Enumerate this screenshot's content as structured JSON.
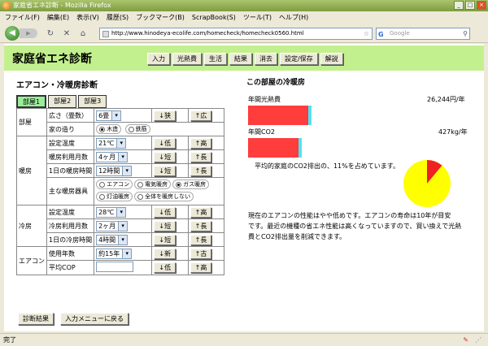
{
  "window": {
    "title": "家庭省エネ診断 - Mozilla Firefox",
    "buttons": [
      "_",
      "□",
      "×"
    ]
  },
  "menu": [
    "ファイル(F)",
    "編集(E)",
    "表示(V)",
    "履歴(S)",
    "ブックマーク(B)",
    "ScrapBook(S)",
    "ツール(T)",
    "ヘルプ(H)"
  ],
  "nav": {
    "url": "http://www.hinodeya-ecolife.com/homecheck/homecheck0560.html",
    "search_placeholder": "Google"
  },
  "header": {
    "title": "家庭省エネ診断",
    "buttons": [
      "入力",
      "光熱費",
      "生活",
      "結果",
      "消去",
      "設定/保存",
      "解説"
    ]
  },
  "form": {
    "title": "エアコン・冷暖房診断",
    "tabs": [
      "部屋1",
      "部屋2",
      "部屋3"
    ],
    "groups": {
      "room": "部屋",
      "heating": "暖房",
      "cooling": "冷房",
      "aircon": "エアコン"
    },
    "rows": {
      "size": {
        "label": "広さ（畳数）",
        "value": "6畳",
        "btn1": "↓狭",
        "btn2": "↑広"
      },
      "structure": {
        "label": "家の造り",
        "opt1": "木造",
        "opt2": "鉄筋"
      },
      "heat_temp": {
        "label": "設定温度",
        "value": "21℃",
        "btn1": "↓低",
        "btn2": "↑高"
      },
      "heat_months": {
        "label": "暖房利用月数",
        "value": "4ヶ月",
        "btn1": "↓短",
        "btn2": "↑長"
      },
      "heat_hours": {
        "label": "1日の暖房時間",
        "value": "12時間",
        "btn1": "↓短",
        "btn2": "↑長"
      },
      "heat_device": {
        "label": "主な暖房器具",
        "opts": [
          "エアコン",
          "電気暖房",
          "ガス暖房",
          "灯油暖房",
          "全体を暖房しない"
        ]
      },
      "cool_temp": {
        "label": "設定温度",
        "value": "28℃",
        "btn1": "↓低",
        "btn2": "↑高"
      },
      "cool_months": {
        "label": "冷房利用月数",
        "value": "2ヶ月",
        "btn1": "↓短",
        "btn2": "↑長"
      },
      "cool_hours": {
        "label": "1日の冷房時間",
        "value": "4時間",
        "btn1": "↓短",
        "btn2": "↑長"
      },
      "ac_years": {
        "label": "使用年数",
        "value": "約15年",
        "btn1": "↓新",
        "btn2": "↑古"
      },
      "ac_cop": {
        "label": "平均COP",
        "value": "",
        "btn1": "↓低",
        "btn2": "↑高"
      }
    },
    "buttons": [
      "診断結果",
      "入力メニューに戻る"
    ]
  },
  "result": {
    "title": "この部屋の冷暖房",
    "cost_label": "年間光熱費",
    "cost_value": "26,244円/年",
    "co2_label": "年間CO2",
    "co2_value": "427kg/年",
    "share_text": "平均的家庭のCO2排出の、11%を占めています。",
    "share_fraction": 0.11,
    "advice_lines": [
      "現在のエアコンの性能はやや低めです。エアコンの寿命は10年が目安",
      "です。最近の機種の省エネ性能は高くなっていますので、買い換えで光熱",
      "費とCO2排出量を削減できます。"
    ],
    "colors": {
      "bar": "#ff3d3d",
      "bar_tip": "#4fe3ef",
      "pie_main": "#ffff00",
      "pie_share": "#ee2222"
    }
  },
  "status": {
    "text": "完了"
  }
}
